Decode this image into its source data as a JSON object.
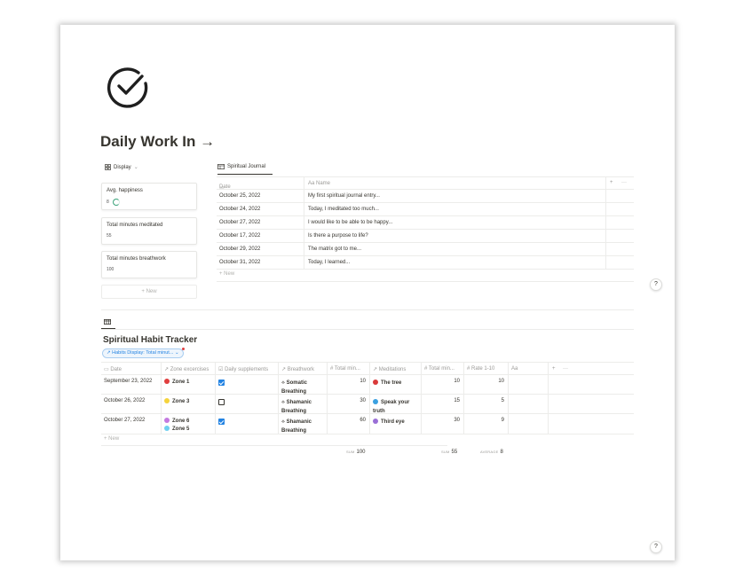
{
  "page": {
    "title": "Daily Work In →",
    "icon": "check-circle-icon"
  },
  "display_button": {
    "label": "Display",
    "icon": "gallery-icon"
  },
  "cards": [
    {
      "title": "Avg. happiness",
      "value": "8",
      "progress": 0.8
    },
    {
      "title": "Total minutes meditated",
      "value": "55"
    },
    {
      "title": "Total minutes breathwork",
      "value": "100"
    }
  ],
  "cards_new": "+ New",
  "journal": {
    "tab": "Spiritual Journal",
    "columns": {
      "date": "Date",
      "name": "Aa Name",
      "add": "+",
      "more": "···"
    },
    "rows": [
      {
        "date": "October 25, 2022",
        "name": "My first spiritual journal entry..."
      },
      {
        "date": "October 24, 2022",
        "name": "Today, I meditated too much..."
      },
      {
        "date": "October 27, 2022",
        "name": "I would like to be able to be happy..."
      },
      {
        "date": "October 17, 2022",
        "name": "Is there a purpose to life?"
      },
      {
        "date": "October 29, 2022",
        "name": "The matrix got to me..."
      },
      {
        "date": "October 31, 2022",
        "name": "Today, I learned..."
      }
    ],
    "new_label": "+ New"
  },
  "habit": {
    "title": "Spiritual Habit Tracker",
    "filter": "↗ Habits Display: Total minut... ⌄",
    "columns": {
      "date": "Date",
      "zone": "↗ Zone excercises",
      "supplements": "Daily supplements",
      "breathwork": "↗ Breathwork",
      "total1": "# Total min...",
      "meditations": "↗ Meditations",
      "total2": "# Total min...",
      "rate": "# Rate 1-10",
      "aa": "Aa",
      "add": "+",
      "more": "···"
    },
    "rows": [
      {
        "date": "September 23, 2022",
        "zones": [
          "Zone 1"
        ],
        "supplements": true,
        "breath1": "Somatic",
        "breath2": "Breathing",
        "total1": "10",
        "med1": "The tree",
        "med2": "",
        "total2": "10",
        "rate": "10"
      },
      {
        "date": "October 26, 2022",
        "zones": [
          "Zone 3"
        ],
        "supplements": false,
        "breath1": "Shamanic",
        "breath2": "Breathing",
        "total1": "30",
        "med1": "Speak your",
        "med2": "truth",
        "total2": "15",
        "rate": "5"
      },
      {
        "date": "October 27, 2022",
        "zones": [
          "Zone 6",
          "Zone 5"
        ],
        "supplements": true,
        "breath1": "Shamanic",
        "breath2": "Breathing",
        "total1": "60",
        "med1": "Third eye",
        "med2": "",
        "total2": "30",
        "rate": "9"
      }
    ],
    "new_label": "+ New",
    "calcs": [
      {
        "label": "SUM",
        "value": "100"
      },
      {
        "label": "SUM",
        "value": "55"
      },
      {
        "label": "AVERAGE",
        "value": "8"
      }
    ]
  },
  "help_label": "?",
  "colors": {
    "accent": "#2383e2",
    "zone1": "#e03e3e",
    "zone3": "#f5d33c",
    "zone6": "#c47ae0",
    "zone5": "#6fd0f0",
    "tree": "#d93a3a",
    "speak": "#3aa0e0",
    "third": "#9a6fd6"
  }
}
